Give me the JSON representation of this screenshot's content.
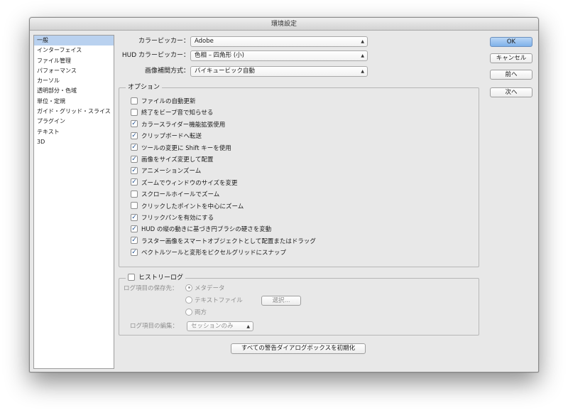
{
  "window": {
    "title": "環境設定"
  },
  "sidebar": {
    "items": [
      {
        "label": "一般",
        "selected": true
      },
      {
        "label": "インターフェイス"
      },
      {
        "label": "ファイル管理"
      },
      {
        "label": "パフォーマンス"
      },
      {
        "label": "カーソル"
      },
      {
        "label": "透明部分・色域"
      },
      {
        "label": "単位・定規"
      },
      {
        "label": "ガイド・グリッド・スライス"
      },
      {
        "label": "プラグイン"
      },
      {
        "label": "テキスト"
      },
      {
        "label": "3D"
      }
    ]
  },
  "general": {
    "color_picker": {
      "label": "カラーピッカー：",
      "value": "Adobe"
    },
    "hud_picker": {
      "label": "HUD カラーピッカー：",
      "value": "色相 – 四角形 (小)"
    },
    "interpolation": {
      "label": "画像補間方式：",
      "value": "バイキュービック自動"
    }
  },
  "options": {
    "title": "オプション",
    "items": [
      {
        "label": "ファイルの自動更新",
        "checked": false
      },
      {
        "label": "終了をビープ音で知らせる",
        "checked": false
      },
      {
        "label": "カラースライダー機能拡張使用",
        "checked": true
      },
      {
        "label": "クリップボードへ転送",
        "checked": true
      },
      {
        "label": "ツールの変更に Shift キーを使用",
        "checked": true
      },
      {
        "label": "画像をサイズ変更して配置",
        "checked": true
      },
      {
        "label": "アニメーションズーム",
        "checked": true
      },
      {
        "label": "ズームでウィンドウのサイズを変更",
        "checked": true
      },
      {
        "label": "スクロールホイールでズーム",
        "checked": false
      },
      {
        "label": "クリックしたポイントを中心にズーム",
        "checked": false
      },
      {
        "label": "フリックパンを有効にする",
        "checked": true
      },
      {
        "label": "HUD の縦の動きに基づき円ブラシの硬さを変動",
        "checked": true
      },
      {
        "label": "ラスター画像をスマートオブジェクトとして配置またはドラッグ",
        "checked": true
      },
      {
        "label": "ベクトルツールと変形をピクセルグリッドにスナップ",
        "checked": true
      }
    ]
  },
  "history": {
    "title": "ヒストリーログ",
    "checked": false,
    "save_label": "ログ項目の保存先：",
    "radios": [
      {
        "label": "メタデータ",
        "selected": true
      },
      {
        "label": "テキストファイル",
        "selected": false
      },
      {
        "label": "両方",
        "selected": false
      }
    ],
    "choose_button": "選択...",
    "edit_label": "ログ項目の編集：",
    "edit_value": "セッションのみ"
  },
  "reset_warnings_button": "すべての警告ダイアログボックスを初期化",
  "buttons": {
    "ok": "OK",
    "cancel": "キャンセル",
    "prev": "前へ",
    "next": "次へ"
  }
}
